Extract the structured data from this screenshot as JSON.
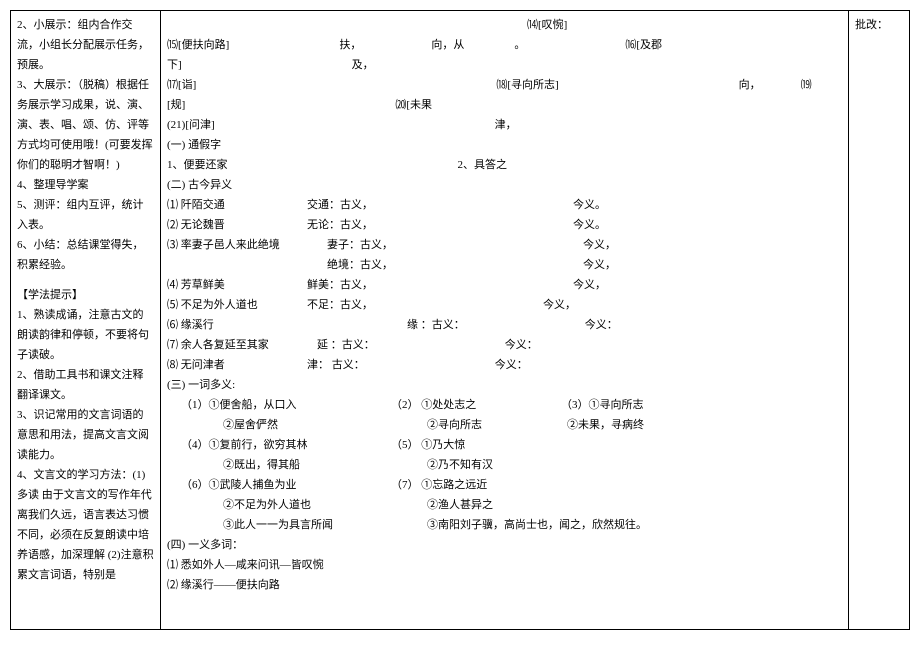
{
  "left": {
    "item2": "2、小展示：组内合作交流，小组长分配展示任务，预展。",
    "item3": "3、大展示：（脱稿）根据任务展示学习成果，说、演、演、表、唱、颂、仿、评等方式均可使用哦！(可要发挥你们的聪明才智啊！)",
    "item4": "4、整理导学案",
    "item5": "5、测评：组内互评，统计入表。",
    "item6": "6、小结：总结课堂得失，积累经验。",
    "blank": "",
    "tips_title": "【学法提示】",
    "tip1": "1、熟读成诵，注意古文的朗读韵律和停顿，不要将句子读破。",
    "tip2": "2、借助工具书和课文注释翻译课文。",
    "tip3": "3、识记常用的文言词语的意思和用法，提高文言文阅读能力。",
    "tip4a": "4、文言文的学习方法：(1)",
    "tip4b": "多读    由于文言文的写作年代离我们久远，语言表达习惯不同，必须在反复朗读中培养语感，加深理解 (2)注意积累文言词语，特别是"
  },
  "middle": {
    "r1a": "⒂[便扶向路]",
    "r1b": "扶，",
    "r1c": "向，从",
    "r1d": "。",
    "r1_right": "⒁[叹惋]",
    "r1_far": "⒃[及郡",
    "r2a": "下]",
    "r2b": "及，",
    "r3a": "⒄[诣]",
    "r3b": "⒅[寻向所志]",
    "r3c": "向，",
    "r3d": "⒆",
    "r4a": "[规]",
    "r4b": "⒇[未果",
    "r5a": "(21)[问津]",
    "r5b": "津，",
    "tongjia_h": "(一) 通假字",
    "tongjia_1": "1、便要还家",
    "tongjia_2": "2、具答之",
    "gujin_h": "(二) 古今异义",
    "gj1a": "⑴   阡陌交通",
    "gj1b": "交通：古义，",
    "gj1c": "今义。",
    "gj2a": "⑵   无论魏晋",
    "gj2b": "无论：古义，",
    "gj2c": "今义。",
    "gj3a": "⑶   率妻子邑人来此绝境",
    "gj3b": "妻子：古义，",
    "gj3c": "今义，",
    "gj3d": "绝境：古义，",
    "gj3e": "今义，",
    "gj4a": "⑷   芳草鲜美",
    "gj4b": "鲜美：古义，",
    "gj4c": "今义，",
    "gj5a": "⑸   不足为外人道也",
    "gj5b": "不足：古义，",
    "gj5c": "今义，",
    "gj6a": "⑹   缘溪行",
    "gj6b": "缘  ：古义：",
    "gj6c": "今义：",
    "gj7a": "⑺   余人各复延至其家",
    "gj7b": "延  ：古义：",
    "gj7c": "今义：",
    "gj8a": "⑻   无问津者",
    "gj8b": "津：  古义：",
    "gj8c": "今义：",
    "duoyi_h": "(三) 一词多义:",
    "dy1a": "（1）①便舍船，从口入",
    "dy1b": "（2）    ①处处志之",
    "dy1c": "（3）①寻向所志",
    "dy2a": "②屋舍俨然",
    "dy2b": "②寻向所志",
    "dy2c": "②未果，寻病终",
    "dy3a": "（4）①复前行，欲穷其林",
    "dy3b": "（5）   ①乃大惊",
    "dy4a": "②既出，得其船",
    "dy4b": "②乃不知有汉",
    "dy5a": "（6）①武陵人捕鱼为业",
    "dy5b": "（7）   ①忘路之远近",
    "dy6a": "②不足为外人道也",
    "dy6b": "②渔人甚异之",
    "dy7a": "③此人一一为具言所闻",
    "dy7b": "③南阳刘子骥，高尚士也，闻之，欣然规往。",
    "yiduoci_h": "(四) 一义多词：",
    "yd1": "⑴  悉如外人—咸来问讯—皆叹惋",
    "yd2": "⑵  缘溪行——便扶向路"
  },
  "right": {
    "label": "批改："
  }
}
